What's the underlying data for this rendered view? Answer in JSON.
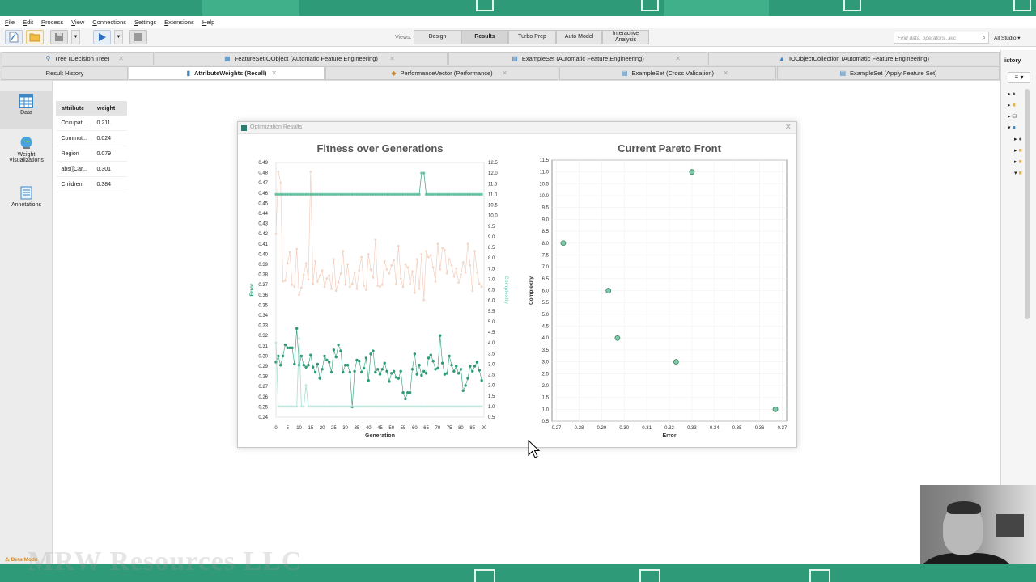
{
  "menu": [
    "File",
    "Edit",
    "Process",
    "View",
    "Connections",
    "Settings",
    "Extensions",
    "Help"
  ],
  "toolbar": {
    "views_label": "Views:",
    "views": [
      "Design",
      "Results",
      "Turbo Prep",
      "Auto Model",
      "Interactive Analysis"
    ],
    "active_view": "Results",
    "search_placeholder": "Find data, operators...etc",
    "studio_selector": "All Studio"
  },
  "tabs_row1": [
    {
      "label": "Tree (Decision Tree)",
      "icon": "tree-icon"
    },
    {
      "label": "FeatureSetIOObject (Automatic Feature Engineering)",
      "icon": "feature-set-icon"
    },
    {
      "label": "ExampleSet (Automatic Feature Engineering)",
      "icon": "table-icon"
    },
    {
      "label": "IOObjectCollection (Automatic Feature Engineering)",
      "icon": "collection-icon"
    }
  ],
  "tabs_row2": [
    {
      "label": "Result History",
      "icon": ""
    },
    {
      "label": "AttributeWeights (Recall)",
      "icon": "weights-icon"
    },
    {
      "label": "PerformanceVector (Performance)",
      "icon": "performance-icon"
    },
    {
      "label": "ExampleSet (Cross Validation)",
      "icon": "table-icon"
    },
    {
      "label": "ExampleSet (Apply Feature Set)",
      "icon": "table-icon"
    }
  ],
  "active_tab": "AttributeWeights (Recall)",
  "sidebar": [
    {
      "label": "Data",
      "icon": "data-grid-icon"
    },
    {
      "label": "Weight Visualizations",
      "icon": "globe-chart-icon"
    },
    {
      "label": "Annotations",
      "icon": "notepad-icon"
    }
  ],
  "weights_table": {
    "headers": [
      "attribute",
      "weight"
    ],
    "rows": [
      [
        "Occupati...",
        "0.211"
      ],
      [
        "Commut...",
        "0.024"
      ],
      [
        "Region",
        "0.079"
      ],
      [
        "abs([Car...",
        "0.301"
      ],
      [
        "Children",
        "0.384"
      ]
    ]
  },
  "right_panel": {
    "title": "istory"
  },
  "dialog": {
    "title": "Optimization Results"
  },
  "colors": {
    "error_series": "#2e9a77",
    "complexity_series": "#8fd6c4",
    "pareto_point": "#7dcaa8",
    "brand_green": "#2e9a77"
  },
  "chart_data": [
    {
      "type": "line",
      "title": "Fitness over Generations",
      "xlabel": "Generation",
      "ylabel": "Error",
      "y2label": "Complexity",
      "xlim": [
        0,
        90
      ],
      "ylim": [
        0.24,
        0.49
      ],
      "y2lim": [
        0.5,
        12.5
      ],
      "xticks": [
        0,
        5,
        10,
        15,
        20,
        25,
        30,
        35,
        40,
        45,
        50,
        55,
        60,
        65,
        70,
        75,
        80,
        85,
        90
      ],
      "yticks": [
        0.24,
        0.25,
        0.26,
        0.27,
        0.28,
        0.29,
        0.3,
        0.31,
        0.32,
        0.33,
        0.34,
        0.35,
        0.36,
        0.37,
        0.38,
        0.39,
        0.4,
        0.41,
        0.42,
        0.43,
        0.44,
        0.45,
        0.46,
        0.47,
        0.48,
        0.49
      ],
      "y2ticks": [
        0.5,
        1.0,
        1.5,
        2.0,
        2.5,
        3.0,
        3.5,
        4.0,
        4.5,
        5.0,
        5.5,
        6.0,
        6.5,
        7.0,
        7.5,
        8.0,
        8.5,
        9.0,
        9.5,
        10.0,
        10.5,
        11.0,
        11.5,
        12.0,
        12.5
      ],
      "series": [
        {
          "name": "Error",
          "axis": "left",
          "style": "best",
          "x": [
            0,
            1,
            2,
            3,
            4,
            5,
            6,
            7,
            8,
            9,
            10,
            11,
            12,
            13,
            14,
            15,
            16,
            17,
            18,
            19,
            20,
            21,
            22,
            23,
            24,
            25,
            26,
            27,
            28,
            29,
            30,
            31,
            32,
            33,
            34,
            35,
            36,
            37,
            38,
            39,
            40,
            41,
            42,
            43,
            44,
            45,
            46,
            47,
            48,
            49,
            50,
            51,
            52,
            53,
            54,
            55,
            56,
            57,
            58,
            59,
            60,
            61,
            62,
            63,
            64,
            65,
            66,
            67,
            68,
            69,
            70,
            71,
            72,
            73,
            74,
            75,
            76,
            77,
            78,
            79,
            80,
            81,
            82,
            83,
            84,
            85,
            86,
            87,
            88,
            89
          ],
          "values": [
            0.294,
            0.3,
            0.291,
            0.3,
            0.311,
            0.308,
            0.308,
            0.308,
            0.292,
            0.327,
            0.291,
            0.3,
            0.291,
            0.289,
            0.291,
            0.301,
            0.289,
            0.284,
            0.292,
            0.278,
            0.287,
            0.3,
            0.296,
            0.294,
            0.284,
            0.306,
            0.299,
            0.311,
            0.305,
            0.284,
            0.291,
            0.291,
            0.284,
            0.25,
            0.285,
            0.296,
            0.295,
            0.284,
            0.288,
            0.298,
            0.276,
            0.302,
            0.305,
            0.284,
            0.287,
            0.282,
            0.287,
            0.293,
            0.285,
            0.275,
            0.283,
            0.285,
            0.279,
            0.278,
            0.285,
            0.264,
            0.258,
            0.264,
            0.264,
            0.287,
            0.302,
            0.282,
            0.291,
            0.281,
            0.285,
            0.283,
            0.298,
            0.301,
            0.295,
            0.287,
            0.288,
            0.32,
            0.293,
            0.282,
            0.283,
            0.3,
            0.291,
            0.285,
            0.29,
            0.283,
            0.287,
            0.266,
            0.271,
            0.278,
            0.29,
            0.285,
            0.29,
            0.294,
            0.286,
            0.276
          ]
        },
        {
          "name": "Error",
          "axis": "left",
          "style": "average",
          "x": [
            0,
            1,
            2,
            3,
            4,
            5,
            6,
            7,
            8,
            9,
            10,
            11,
            12,
            13,
            14,
            15,
            16,
            17,
            18,
            19,
            20,
            21,
            22,
            23,
            24,
            25,
            26,
            27,
            28,
            29,
            30,
            31,
            32,
            33,
            34,
            35,
            36,
            37,
            38,
            39,
            40,
            41,
            42,
            43,
            44,
            45,
            46,
            47,
            48,
            49,
            50,
            51,
            52,
            53,
            54,
            55,
            56,
            57,
            58,
            59,
            60,
            61,
            62,
            63,
            64,
            65,
            66,
            67,
            68,
            69,
            70,
            71,
            72,
            73,
            74,
            75,
            76,
            77,
            78,
            79,
            80,
            81,
            82,
            83,
            84,
            85,
            86,
            87,
            88,
            89
          ],
          "values": [
            0.42,
            0.481,
            0.47,
            0.373,
            0.374,
            0.391,
            0.402,
            0.37,
            0.368,
            0.405,
            0.36,
            0.367,
            0.38,
            0.391,
            0.375,
            0.481,
            0.371,
            0.393,
            0.373,
            0.379,
            0.384,
            0.368,
            0.376,
            0.379,
            0.366,
            0.395,
            0.364,
            0.372,
            0.381,
            0.403,
            0.37,
            0.39,
            0.368,
            0.371,
            0.382,
            0.366,
            0.384,
            0.397,
            0.369,
            0.365,
            0.4,
            0.385,
            0.377,
            0.414,
            0.369,
            0.368,
            0.37,
            0.393,
            0.385,
            0.381,
            0.389,
            0.394,
            0.371,
            0.408,
            0.376,
            0.368,
            0.39,
            0.387,
            0.371,
            0.383,
            0.362,
            0.395,
            0.366,
            0.4,
            0.355,
            0.403,
            0.397,
            0.399,
            0.387,
            0.373,
            0.41,
            0.385,
            0.406,
            0.404,
            0.381,
            0.395,
            0.389,
            0.378,
            0.386,
            0.372,
            0.38,
            0.392,
            0.382,
            0.41,
            0.389,
            0.364,
            0.403,
            0.382,
            0.371,
            0.368
          ]
        },
        {
          "name": "Complexity",
          "axis": "right",
          "style": "best",
          "x": [
            0,
            1,
            2,
            3,
            4,
            5,
            6,
            7,
            8,
            9,
            10,
            11,
            12,
            13,
            14,
            15,
            16,
            17,
            18,
            19,
            20,
            21,
            22,
            23,
            24,
            25,
            26,
            27,
            28,
            29,
            30,
            31,
            32,
            33,
            34,
            35,
            36,
            37,
            38,
            39,
            40,
            41,
            42,
            43,
            44,
            45,
            46,
            47,
            48,
            49,
            50,
            51,
            52,
            53,
            54,
            55,
            56,
            57,
            58,
            59,
            60,
            61,
            62,
            63,
            64,
            65,
            66,
            67,
            68,
            69,
            70,
            71,
            72,
            73,
            74,
            75,
            76,
            77,
            78,
            79,
            80,
            81,
            82,
            83,
            84,
            85,
            86,
            87,
            88,
            89
          ],
          "values": [
            11,
            11,
            11,
            11,
            11,
            11,
            11,
            11,
            11,
            11,
            11,
            11,
            11,
            11,
            11,
            11,
            11,
            11,
            11,
            11,
            11,
            11,
            11,
            11,
            11,
            11,
            11,
            11,
            11,
            11,
            11,
            11,
            11,
            11,
            11,
            11,
            11,
            11,
            11,
            11,
            11,
            11,
            11,
            11,
            11,
            11,
            11,
            11,
            11,
            11,
            11,
            11,
            11,
            11,
            11,
            11,
            11,
            11,
            11,
            11,
            11,
            11,
            11,
            12,
            12,
            11,
            11,
            11,
            11,
            11,
            11,
            11,
            11,
            11,
            11,
            11,
            11,
            11,
            11,
            11,
            11,
            11,
            11,
            11,
            11,
            11,
            11,
            11,
            11,
            11
          ]
        },
        {
          "name": "Complexity",
          "axis": "right",
          "style": "average",
          "x": [
            0,
            1,
            2,
            3,
            4,
            5,
            6,
            7,
            8,
            9,
            10,
            11,
            12,
            13,
            14,
            15,
            16,
            17,
            18,
            19,
            20,
            21,
            22,
            23,
            24,
            25,
            26,
            27,
            28,
            29,
            30,
            31,
            32,
            33,
            34,
            35,
            36,
            37,
            38,
            39,
            40,
            41,
            42,
            43,
            44,
            45,
            46,
            47,
            48,
            49,
            50,
            51,
            52,
            53,
            54,
            55,
            56,
            57,
            58,
            59,
            60,
            61,
            62,
            63,
            64,
            65,
            66,
            67,
            68,
            69,
            70,
            71,
            72,
            73,
            74,
            75,
            76,
            77,
            78,
            79,
            80,
            81,
            82,
            83,
            84,
            85,
            86,
            87,
            88,
            89
          ],
          "values": [
            4,
            1,
            1,
            1,
            1,
            1,
            1,
            1,
            1,
            1,
            4.2,
            1,
            1,
            2,
            1,
            1,
            1,
            1,
            1,
            1,
            1,
            1,
            1,
            1,
            1,
            1,
            1,
            1,
            1,
            1,
            1,
            1,
            1,
            1,
            1,
            1,
            1,
            1,
            1,
            1,
            1,
            1,
            1,
            1,
            1,
            1,
            1,
            1,
            1,
            1,
            1,
            1,
            1,
            1,
            1,
            1,
            1,
            1,
            1,
            1,
            1,
            1,
            1,
            1,
            1,
            1,
            1,
            1,
            1,
            1,
            1,
            1,
            1,
            1,
            1,
            1,
            1,
            1,
            1,
            1,
            1,
            1,
            1,
            1,
            1,
            1,
            1,
            1,
            1,
            1
          ]
        }
      ]
    },
    {
      "type": "scatter",
      "title": "Current Pareto Front",
      "xlabel": "Error",
      "ylabel": "Complexity",
      "xlim": [
        0.268,
        0.372
      ],
      "ylim": [
        0.5,
        11.5
      ],
      "xticks": [
        0.27,
        0.28,
        0.29,
        0.3,
        0.31,
        0.32,
        0.33,
        0.34,
        0.35,
        0.36,
        0.37
      ],
      "yticks": [
        0.5,
        1.0,
        1.5,
        2.0,
        2.5,
        3.0,
        3.5,
        4.0,
        4.5,
        5.0,
        5.5,
        6.0,
        6.5,
        7.0,
        7.5,
        8.0,
        8.5,
        9.0,
        9.5,
        10.0,
        10.5,
        11.0,
        11.5
      ],
      "points": [
        {
          "x": 0.273,
          "y": 8.0
        },
        {
          "x": 0.293,
          "y": 6.0
        },
        {
          "x": 0.297,
          "y": 4.0
        },
        {
          "x": 0.323,
          "y": 3.0
        },
        {
          "x": 0.33,
          "y": 11.0
        },
        {
          "x": 0.367,
          "y": 1.0
        }
      ]
    }
  ]
}
